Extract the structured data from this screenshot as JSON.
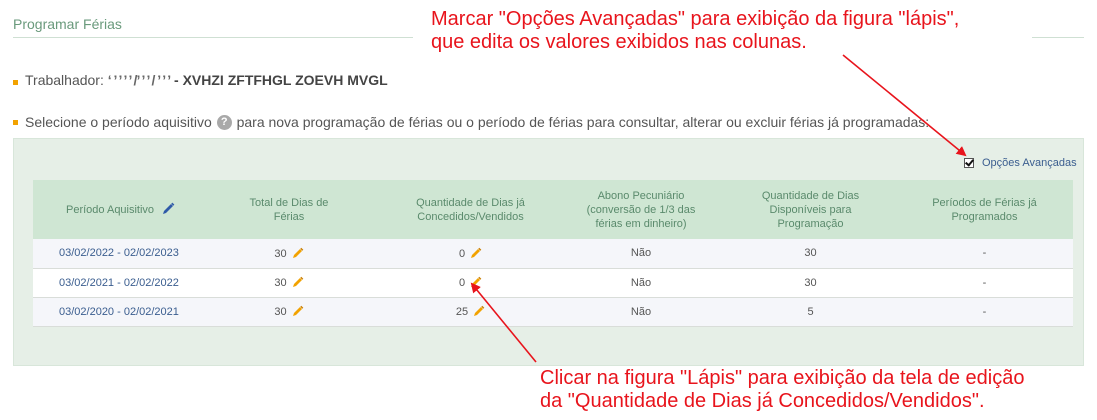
{
  "header": {
    "title": "Programar Férias"
  },
  "worker": {
    "label": "Trabalhador:",
    "id_masked": "‘ ’ ’ ’ ’ /’ ’ ’ / ’  ’ ’",
    "name": "- XVHZI ZFTFHGL ZOEVH MVGL"
  },
  "instruction": {
    "text_before": "Selecione o período aquisitivo",
    "text_after": "para nova programação de férias ou o período de férias para consultar, alterar ou excluir férias já programadas:",
    "help_glyph": "?"
  },
  "options": {
    "advanced_label": "Opções Avançadas",
    "advanced_checked": true
  },
  "table": {
    "headers": {
      "period": "Período Aquisitivo",
      "total": [
        "Total de Dias de",
        "Férias"
      ],
      "granted": [
        "Quantidade de Dias já",
        "Concedidos/Vendidos"
      ],
      "abono": [
        "Abono Pecuniário",
        "(conversão de 1/3 das",
        "férias em dinheiro)"
      ],
      "available": [
        "Quantidade de Dias",
        "Disponíveis para",
        "Programação"
      ],
      "programmed": [
        "Períodos de Férias já",
        "Programados"
      ]
    },
    "rows": [
      {
        "period": "03/02/2022 - 02/02/2023",
        "total": "30",
        "granted": "0",
        "abono": "Não",
        "available": "30",
        "programmed": "-"
      },
      {
        "period": "03/02/2021 - 02/02/2022",
        "total": "30",
        "granted": "0",
        "abono": "Não",
        "available": "30",
        "programmed": "-"
      },
      {
        "period": "03/02/2020 - 02/02/2021",
        "total": "30",
        "granted": "25",
        "abono": "Não",
        "available": "5",
        "programmed": "-"
      }
    ]
  },
  "annotations": {
    "top": [
      "Marcar \"Opções Avançadas\" para exibição da figura \"lápis\",",
      "que edita os valores exibidos nas colunas."
    ],
    "bottom": [
      "Clicar na figura \"Lápis\" para exibição da tela de edição",
      "da \"Quantidade de Dias já Concedidos/Vendidos\"."
    ]
  },
  "colors": {
    "annotation": "#e8141c",
    "panel_bg": "#e6efe7",
    "header_bg": "#cfe6d3",
    "link": "#3a5d8f",
    "pencil": "#f2a200",
    "bullet": "#f2a200"
  },
  "icons": {
    "pencil": "pencil-icon",
    "help": "help-icon",
    "header_edit": "edit-pencil-icon"
  }
}
